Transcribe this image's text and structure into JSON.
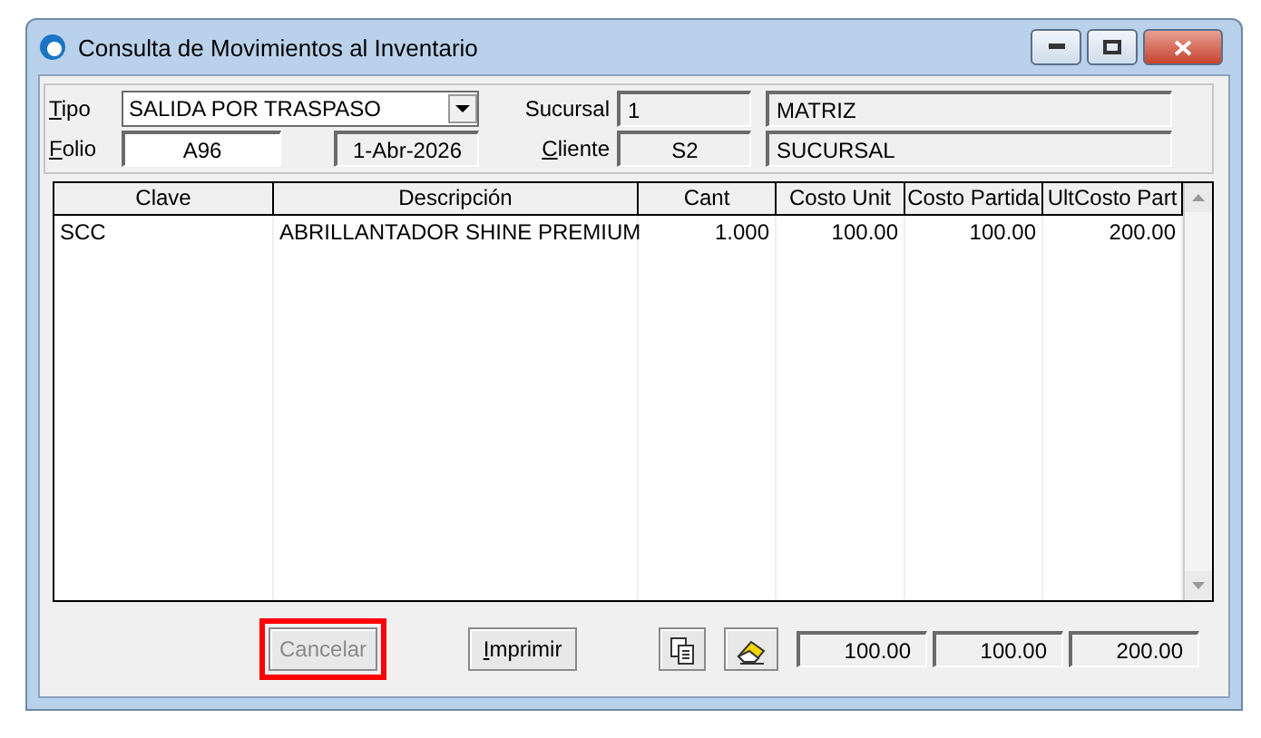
{
  "window": {
    "title": "Consulta de Movimientos al Inventario"
  },
  "header": {
    "tipo": {
      "label": "Tipo",
      "underlined": true,
      "value": "SALIDA POR TRASPASO"
    },
    "folio": {
      "label": "Folio",
      "underlined": true,
      "value": "A96",
      "date": "1-Abr-2026"
    },
    "sucursal": {
      "label": "Sucursal",
      "underlined": false,
      "code": "1",
      "name": "MATRIZ"
    },
    "cliente": {
      "label": "Cliente",
      "underlined": true,
      "code": "S2",
      "name": "SUCURSAL"
    }
  },
  "table": {
    "columns": [
      "Clave",
      "Descripción",
      "Cant",
      "Costo Unit",
      "Costo Partida",
      "UltCosto Part"
    ],
    "rows": [
      [
        "SCC",
        "ABRILLANTADOR SHINE PREMIUM",
        "1.000",
        "100.00",
        "100.00",
        "200.00"
      ]
    ]
  },
  "buttons": [
    {
      "kind": "text",
      "label": "Cancelar",
      "disabled": true,
      "highlighted": true,
      "underlined": false
    },
    {
      "kind": "text",
      "label": "Imprimir",
      "disabled": false,
      "highlighted": false,
      "underlined": true
    },
    {
      "kind": "copy"
    },
    {
      "kind": "eraser"
    }
  ],
  "totals": [
    "100.00",
    "100.00",
    "200.00"
  ]
}
